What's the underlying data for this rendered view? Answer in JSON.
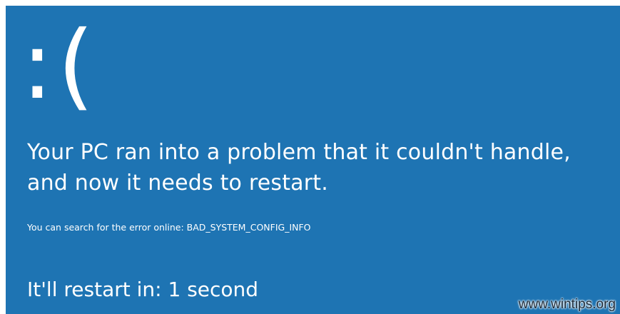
{
  "screen": {
    "background_color": "#1e74b3",
    "text_color": "#ffffff",
    "sad_face": ":(",
    "headline": "Your PC ran into a problem that it couldn't handle, and now it needs to restart.",
    "search_text": "You can search for the error online: BAD_SYSTEM_CONFIG_INFO",
    "restart_text": "It'll restart in: 1 second"
  },
  "watermark": {
    "text": "www.wintips.org"
  }
}
